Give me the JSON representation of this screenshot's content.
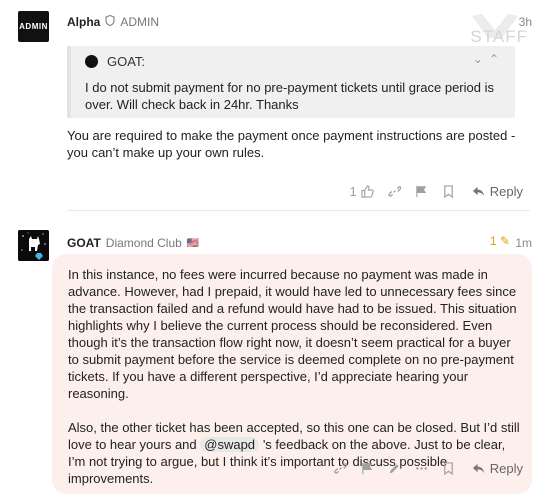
{
  "post1": {
    "avatar_text": "ADMIN",
    "username": "Alpha",
    "user_title": "ADMIN",
    "time": "3h",
    "badge_text": "STAFF",
    "quote": {
      "author": "GOAT:",
      "text": "I do not submit payment for no pre-payment tickets until grace period is over. Will check back in 24hr. Thanks"
    },
    "body": "You are required to make the payment once payment instructions are posted - you can’t make up your own rules.",
    "like_count": "1",
    "reply_label": "Reply"
  },
  "post2": {
    "username": "GOAT",
    "user_title": "Diamond Club",
    "flag": "🇺🇸",
    "edit_count": "1",
    "time": "1m",
    "paragraph1": "In this instance, no fees were incurred because no payment was made in advance. However, had I prepaid, it would have led to unnecessary fees since the transaction failed and a refund would have had to be issued. This situation highlights why I believe the current process should be reconsidered. Even though it’s the transaction flow right now, it doesn’t seem practical for a buyer to submit payment before the service is deemed complete on no pre-payment tickets. If you have a different perspective, I’d appreciate hearing your reasoning.",
    "paragraph2_before": "Also, the other ticket has been accepted, so this one can be closed. But I’d still love to hear yours and ",
    "mention": "@swapd",
    "paragraph2_after": " ’s feedback on the above. Just to be clear, I’m not trying to argue, but I think it’s important to discuss possible improvements.",
    "reply_label": "Reply"
  },
  "colors": {
    "highlight_bg": "#fdf0ec",
    "quote_bg": "#f0f0f0",
    "icon_gray": "#a0a0a0",
    "edit_accent": "#e2a000"
  }
}
